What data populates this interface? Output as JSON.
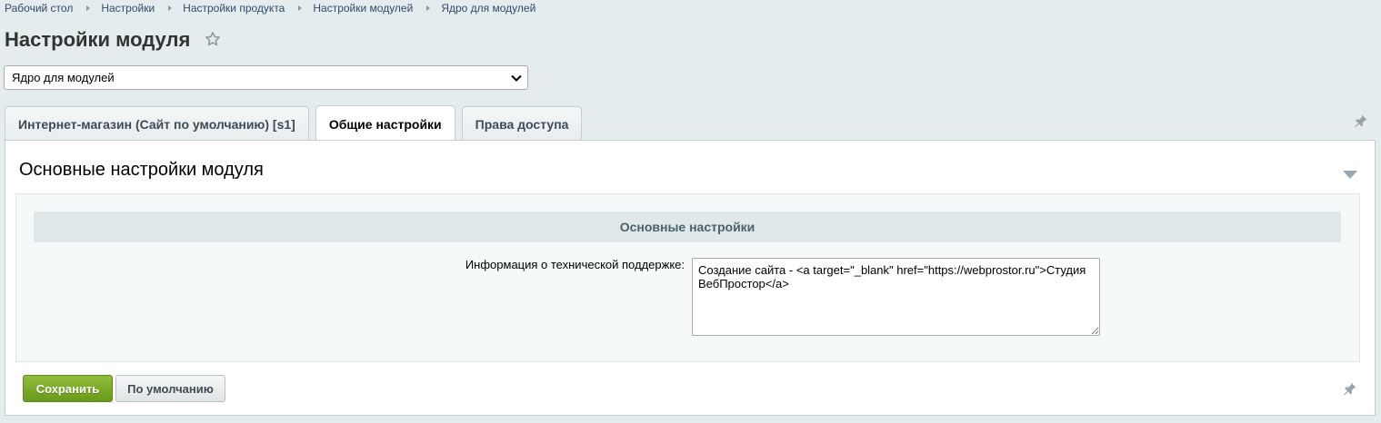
{
  "breadcrumb": [
    {
      "label": "Рабочий стол"
    },
    {
      "label": "Настройки"
    },
    {
      "label": "Настройки продукта"
    },
    {
      "label": "Настройки модулей"
    },
    {
      "label": "Ядро для модулей"
    }
  ],
  "header": {
    "title": "Настройки модуля"
  },
  "module_select": {
    "value": "Ядро для модулей"
  },
  "tabs": [
    {
      "label": "Интернет-магазин (Сайт по умолчанию) [s1]",
      "active": false
    },
    {
      "label": "Общие настройки",
      "active": true
    },
    {
      "label": "Права доступа",
      "active": false
    }
  ],
  "panel": {
    "section_title": "Основные настройки модуля",
    "subheading": "Основные настройки",
    "field_label": "Информация о технической поддержке:",
    "field_value": "Создание сайта - <a target=\"_blank\" href=\"https://webprostor.ru\">Студия ВебПростор</a>"
  },
  "buttons": {
    "save": "Сохранить",
    "default": "По умолчанию"
  },
  "colors": {
    "save_green": "#7aad28",
    "background": "#e5ecee",
    "tab_active": "#ffffff"
  }
}
